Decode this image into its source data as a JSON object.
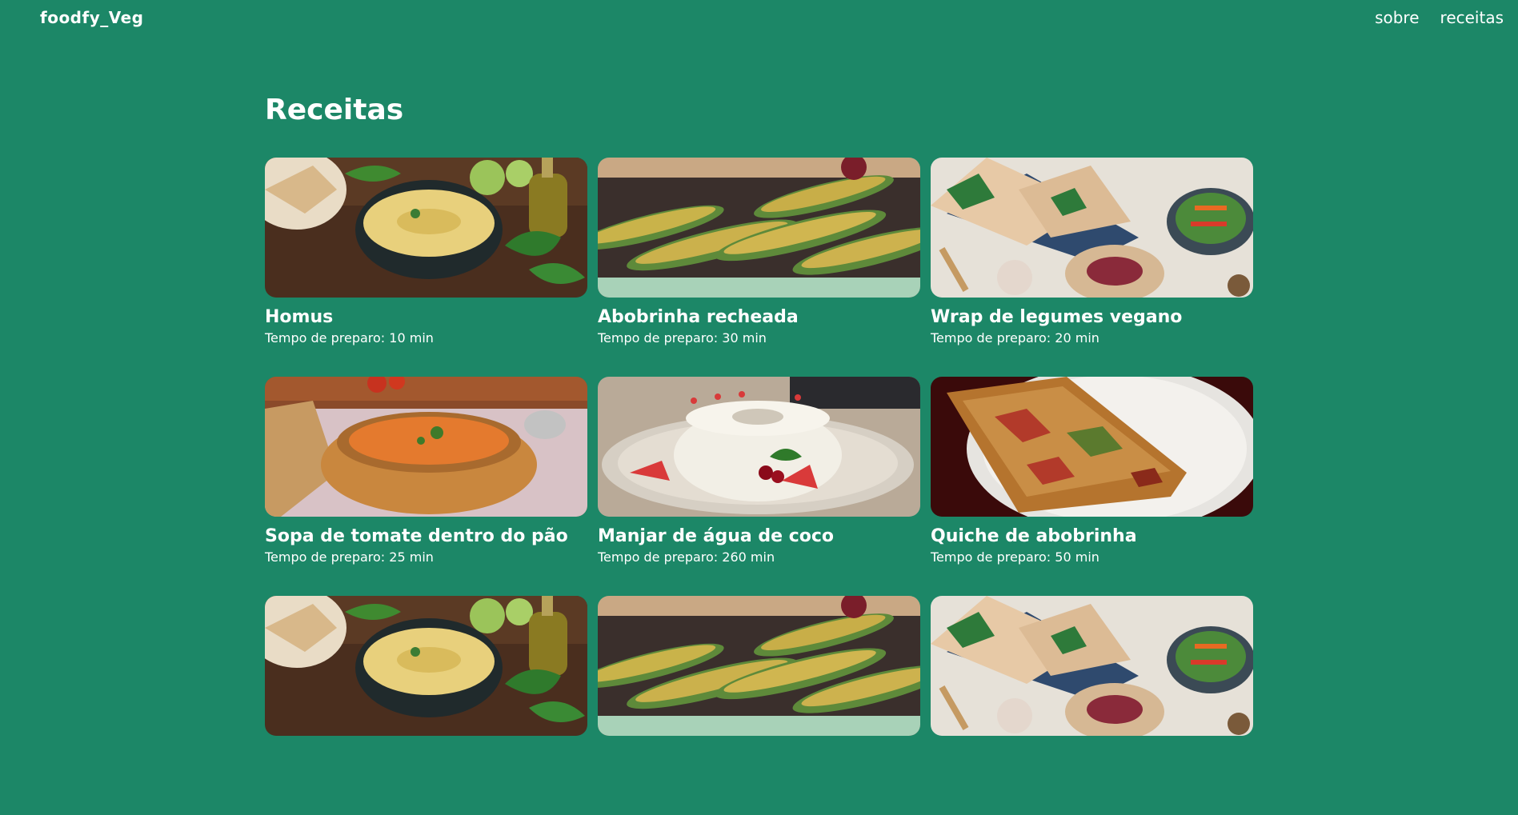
{
  "header": {
    "brand": "foodfy_Veg",
    "nav": [
      {
        "label": "sobre"
      },
      {
        "label": "receitas"
      }
    ]
  },
  "main": {
    "title": "Receitas",
    "recipes": [
      {
        "title": "Homus",
        "meta": "Tempo de preparo: 10 min",
        "image": "hummus-photo"
      },
      {
        "title": "Abobrinha recheada",
        "meta": "Tempo de preparo: 30 min",
        "image": "stuffed-zucchini-photo"
      },
      {
        "title": "Wrap de legumes vegano",
        "meta": "Tempo de preparo: 20 min",
        "image": "vegan-wrap-photo"
      },
      {
        "title": "Sopa de tomate dentro do pão",
        "meta": "Tempo de preparo: 25 min",
        "image": "tomato-soup-bread-bowl-photo"
      },
      {
        "title": "Manjar de água de coco",
        "meta": "Tempo de preparo: 260 min",
        "image": "coconut-pudding-photo"
      },
      {
        "title": "Quiche de abobrinha",
        "meta": "Tempo de preparo: 50 min",
        "image": "zucchini-quiche-photo"
      },
      {
        "title": "",
        "meta": "",
        "image": "hummus-photo"
      },
      {
        "title": "",
        "meta": "",
        "image": "stuffed-zucchini-photo"
      },
      {
        "title": "",
        "meta": "",
        "image": "vegan-wrap-photo"
      }
    ]
  },
  "colors": {
    "background": "#1c8767",
    "text": "#ffffff"
  }
}
